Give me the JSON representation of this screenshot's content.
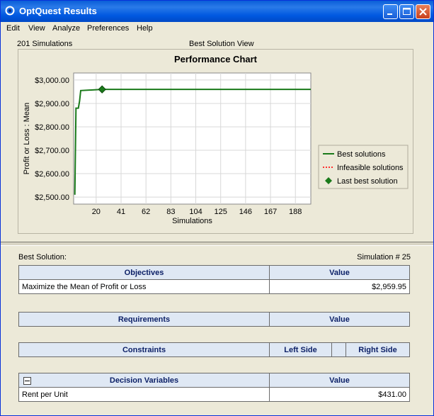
{
  "window": {
    "title": "OptQuest Results"
  },
  "menu": [
    "Edit",
    "View",
    "Analyze",
    "Preferences",
    "Help"
  ],
  "top_panel": {
    "simulations_label": "201 Simulations",
    "view_label": "Best Solution View"
  },
  "chart_data": {
    "type": "line",
    "title": "Performance Chart",
    "xlabel": "Simulations",
    "ylabel": "Profit or Loss : Mean",
    "x_ticks": [
      20,
      41,
      62,
      83,
      104,
      125,
      146,
      167,
      188
    ],
    "y_ticks": [
      "$2,500.00",
      "$2,600.00",
      "$2,700.00",
      "$2,800.00",
      "$2,900.00",
      "$3,000.00"
    ],
    "xlim": [
      1,
      201
    ],
    "ylim": [
      2470,
      3030
    ],
    "grid": true,
    "legend_placement": "right",
    "series": [
      {
        "name": "Best solutions",
        "color": "#1a7a1a",
        "style": "solid",
        "points": [
          [
            2,
            2510
          ],
          [
            3,
            2880
          ],
          [
            5,
            2880
          ],
          [
            6,
            2910
          ],
          [
            7,
            2955
          ],
          [
            25,
            2960
          ],
          [
            201,
            2960
          ]
        ]
      },
      {
        "name": "Infeasible solutions",
        "color": "#ff3030",
        "style": "dotted",
        "points": []
      },
      {
        "name": "Last best solution",
        "color": "#1a7a1a",
        "style": "diamond",
        "points": [
          [
            25,
            2960
          ]
        ]
      }
    ]
  },
  "bottom_panel": {
    "best_solution_label": "Best Solution:",
    "simulation_number": "Simulation # 25",
    "objectives": {
      "header": "Objectives",
      "value_header": "Value",
      "rows": [
        {
          "name": "Maximize the Mean of Profit or Loss",
          "value": "$2,959.95"
        }
      ]
    },
    "requirements": {
      "header": "Requirements",
      "value_header": "Value"
    },
    "constraints": {
      "header": "Constraints",
      "left_header": "Left Side",
      "right_header": "Right Side"
    },
    "decision_variables": {
      "header": "Decision Variables",
      "value_header": "Value",
      "rows": [
        {
          "name": "Rent per Unit",
          "value": "$431.00"
        }
      ]
    }
  }
}
